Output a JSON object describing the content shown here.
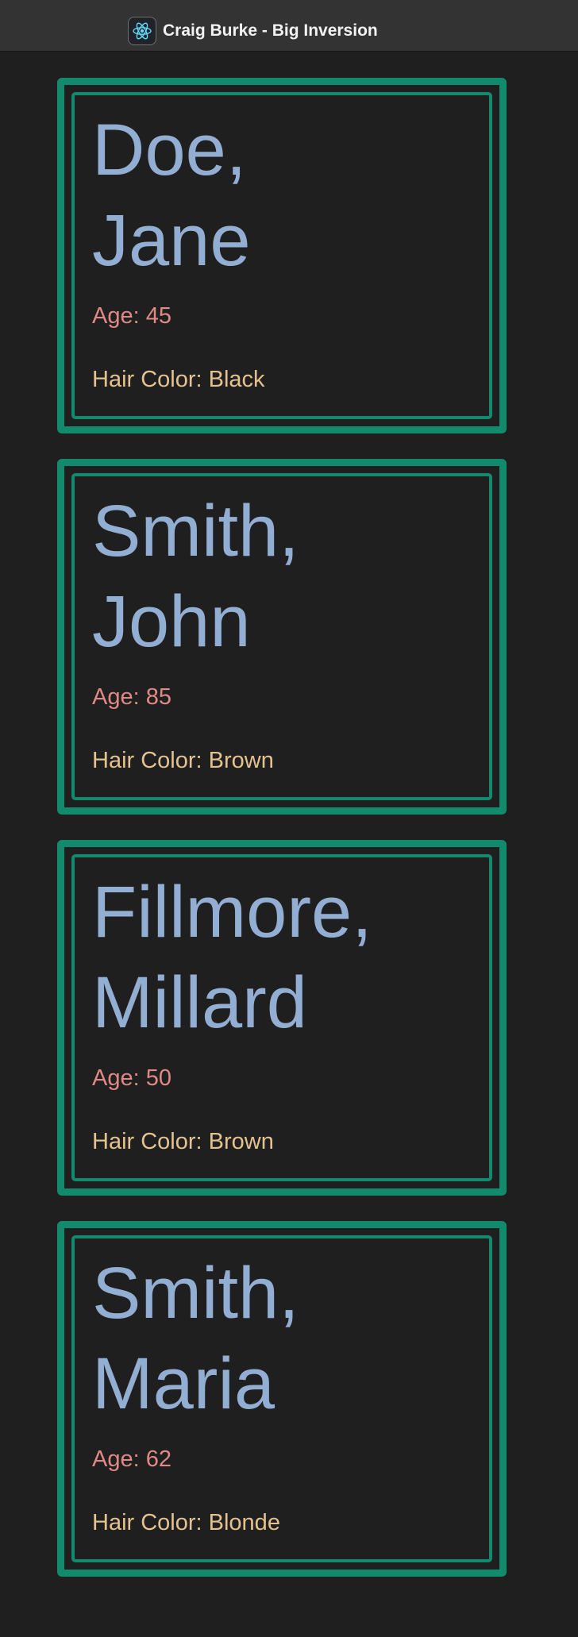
{
  "window": {
    "title": "Craig Burke - Big Inversion",
    "icon": "react-atom-icon"
  },
  "colors": {
    "background": "#1f1f1f",
    "titlebar": "#333333",
    "card_border": "#128a6c",
    "name": "#93aed3",
    "age": "#df8a87",
    "hair": "#e3c290"
  },
  "people": [
    {
      "last_name": "Doe,",
      "first_name": "Jane",
      "age_text": "Age: 45",
      "hair_text": "Hair Color: Black"
    },
    {
      "last_name": "Smith,",
      "first_name": "John",
      "age_text": "Age: 85",
      "hair_text": "Hair Color: Brown"
    },
    {
      "last_name": "Fillmore,",
      "first_name": "Millard",
      "age_text": "Age: 50",
      "hair_text": "Hair Color: Brown"
    },
    {
      "last_name": "Smith,",
      "first_name": "Maria",
      "age_text": "Age: 62",
      "hair_text": "Hair Color: Blonde"
    }
  ]
}
